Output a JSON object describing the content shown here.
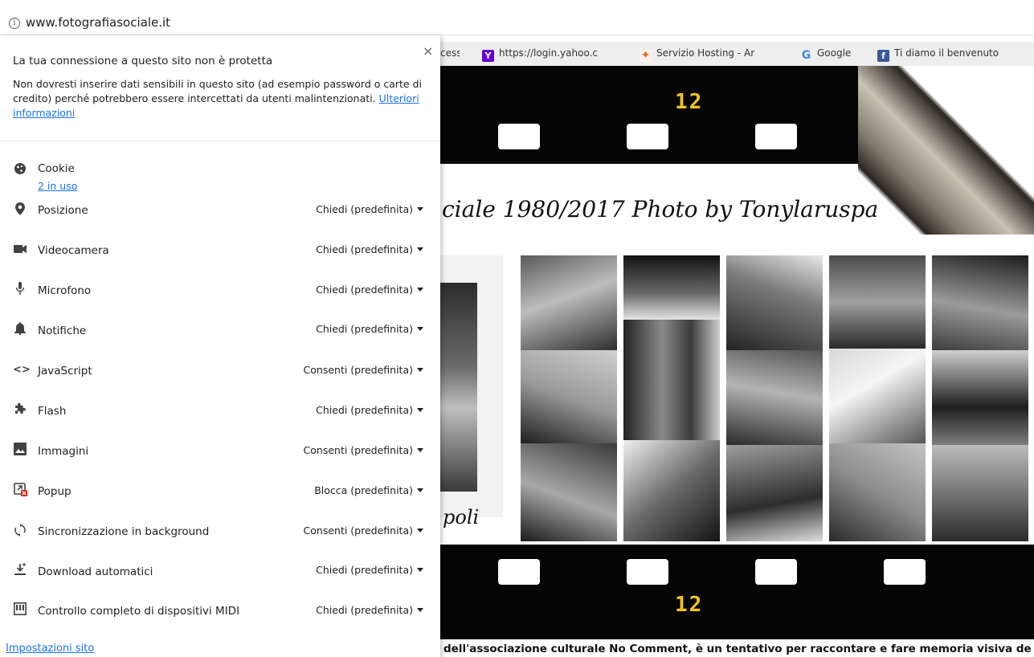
{
  "address_bar": {
    "url": "www.fotografiasociale.it",
    "info_icon": "info-circle-icon"
  },
  "bookmarks": [
    {
      "label": "cess",
      "icon": ""
    },
    {
      "label": "https://login.yahoo.c",
      "icon": "yahoo-icon"
    },
    {
      "label": "Servizio Hosting - Ar",
      "icon": "hosting-icon"
    },
    {
      "label": "Google",
      "icon": "google-icon"
    },
    {
      "label": "Ti diamo il benvenuto",
      "icon": "facebook-icon"
    }
  ],
  "popup": {
    "heading": "La tua connessione a questo sito non è protetta",
    "body": "Non dovresti inserire dati sensibili in questo sito (ad esempio password o carte di credito) perché potrebbero essere intercettati da utenti malintenzionati.",
    "more_info_link": "Ulteriori informazioni",
    "close_label": "×",
    "cookies": {
      "label": "Cookie",
      "in_use": "2 in uso"
    },
    "permissions": [
      {
        "label": "Posizione",
        "value": "Chiedi (predefinita)",
        "icon": "location-pin-icon"
      },
      {
        "label": "Videocamera",
        "value": "Chiedi (predefinita)",
        "icon": "camera-icon"
      },
      {
        "label": "Microfono",
        "value": "Chiedi (predefinita)",
        "icon": "microphone-icon"
      },
      {
        "label": "Notifiche",
        "value": "Chiedi (predefinita)",
        "icon": "bell-icon"
      },
      {
        "label": "JavaScript",
        "value": "Consenti (predefinita)",
        "icon": "code-icon"
      },
      {
        "label": "Flash",
        "value": "Chiedi (predefinita)",
        "icon": "puzzle-icon"
      },
      {
        "label": "Immagini",
        "value": "Consenti (predefinita)",
        "icon": "image-icon"
      },
      {
        "label": "Popup",
        "value": "Blocca (predefinita)",
        "icon": "popup-blocked-icon"
      },
      {
        "label": "Sincronizzazione in background",
        "value": "Consenti (predefinita)",
        "icon": "sync-icon"
      },
      {
        "label": "Download automatici",
        "value": "Chiedi (predefinita)",
        "icon": "download-icon"
      },
      {
        "label": "Controllo completo di dispositivi MIDI",
        "value": "Chiedi (predefinita)",
        "icon": "midi-icon"
      }
    ],
    "site_settings_link": "Impostazioni sito"
  },
  "website": {
    "frame_number_top": "12",
    "frame_number_bottom": "12",
    "title": "ciale 1980/2017 Photo by Tonylaruspa",
    "left_text": "poli",
    "caption": "dell'associazione culturale No Comment, è un tentativo per raccontare e fare memoria visiva de"
  }
}
